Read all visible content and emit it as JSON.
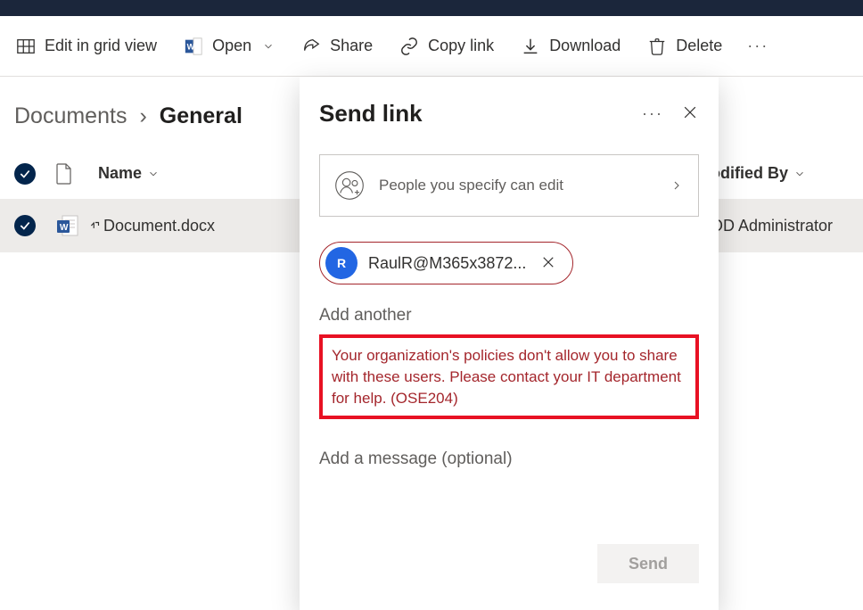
{
  "toolbar": {
    "edit_grid": "Edit in grid view",
    "open": "Open",
    "share": "Share",
    "copy_link": "Copy link",
    "download": "Download",
    "delete": "Delete"
  },
  "breadcrumb": {
    "root": "Documents",
    "current": "General"
  },
  "columns": {
    "name": "Name",
    "modified_by": "Modified By"
  },
  "file": {
    "name": "Document.docx",
    "modified_by": "MOD Administrator"
  },
  "panel": {
    "title": "Send link",
    "permission_text": "People you specify can edit",
    "recipient_initial": "R",
    "recipient_email": "RaulR@M365x3872...",
    "add_another": "Add another",
    "error": "Your organization's policies don't allow you to share with these users. Please contact your IT department for help. (OSE204)",
    "message_placeholder": "Add a message (optional)",
    "send": "Send"
  }
}
